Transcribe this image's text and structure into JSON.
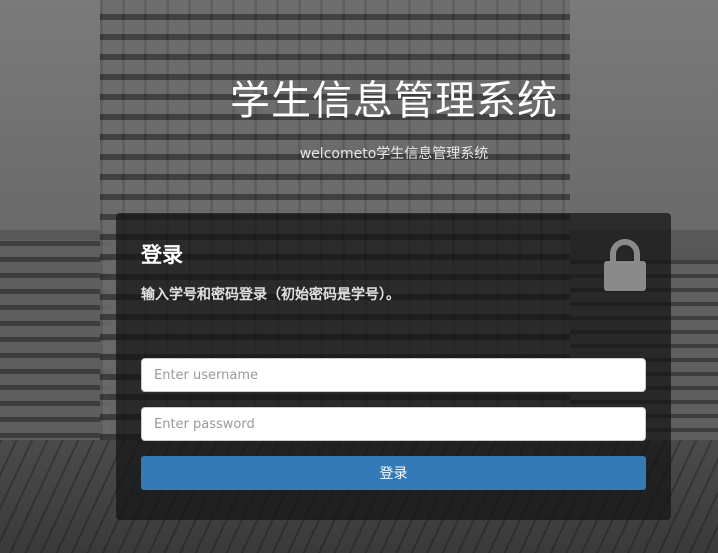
{
  "header": {
    "title": "学生信息管理系统",
    "subtitle": "welcometo学生信息管理系统"
  },
  "login_panel": {
    "title": "登录",
    "description": "输入学号和密码登录（初始密码是学号）。",
    "icon": "lock-icon",
    "username_placeholder": "Enter username",
    "username_value": "",
    "password_placeholder": "Enter password",
    "password_value": "",
    "submit_label": "登录"
  },
  "colors": {
    "primary_button": "#337ab7",
    "panel_bg": "rgba(20,20,20,0.72)",
    "text_light": "#ffffff"
  }
}
